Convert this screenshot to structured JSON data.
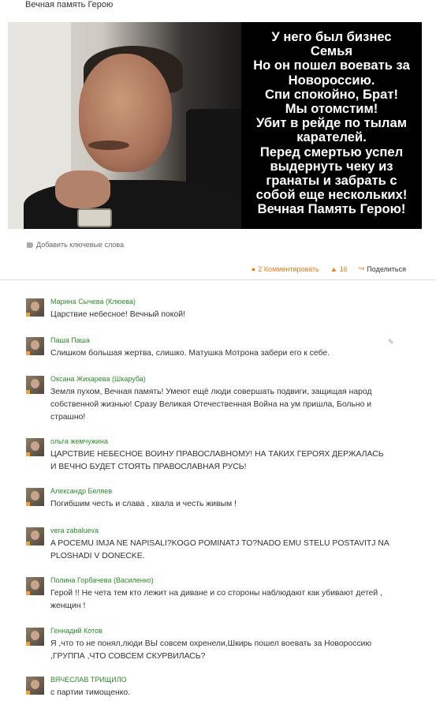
{
  "post": {
    "title": "Вечная память Герою",
    "image_caption_lines": [
      "У него был бизнес",
      "Семья",
      "Но он пошел воевать за",
      "Новороссию.",
      "Спи спокойно, Брат!",
      "Мы отомстим!",
      "Убит в рейде по тылам",
      "карателей.",
      "Перед смертью успел",
      "выдернуть чеку из",
      "гранаты и забрать с",
      "собой еще нескольких!",
      "Вечная Память Герою!"
    ],
    "keywords_link": "Добавить ключевые слова"
  },
  "actions": {
    "comment_label": "2 Комментировать",
    "likes_count": "16",
    "share_label": "Поделиться"
  },
  "colors": {
    "accent": "#eb7a1e",
    "author_name": "#2d8b2d",
    "text": "#333333"
  },
  "comments": [
    {
      "author": "Марина Сычева (Клюева)",
      "text": "Царствие небесное! Вечный покой!"
    },
    {
      "author": "Паша Паша",
      "text": "Слишком большая жертва, слишко. Матушка Мотрона забери его к себе."
    },
    {
      "author": "Оксана Жихарева (Шкаруба)",
      "lines": [
        "Земля пухом, Вечная память! Умеют ещё люди совершать подвиги, защищая народ",
        "собственной жизнью! Сразу Великая Отечественная Война на ум пришла, Больно и",
        "страшно!"
      ]
    },
    {
      "author": "ольга жемчужина",
      "lines": [
        "ЦАРСТВИЕ НЕБЕСНОЕ  ВОИНУ ПРАВОСЛАВНОМУ! НА ТАКИХ ГЕРОЯХ ДЕРЖАЛАСЬ",
        "И ВЕЧНО БУДЕТ СТОЯТЬ ПРАВОСЛАВНАЯ РУСЬ!"
      ]
    },
    {
      "author": "Александр Беляев",
      "text": "Погибшим  честь  и  слава ,  хвала  и  честь  живым !"
    },
    {
      "author": "vera zabalueva",
      "lines": [
        "A POCEMU IMJA NE NAPISALI?KOGO POMINATJ TO?NADO EMU STELU POSTAVITJ NA",
        "PLOSHADI V DONECKE."
      ]
    },
    {
      "author": "Полина Горбачева (Василенко)",
      "lines": [
        "Герой !! Не чета тем кто лежит на диване и со стороны наблюдают как убивают детей ,",
        "женщин !"
      ]
    },
    {
      "author": "Геннадий Котов",
      "lines": [
        "Я ,что то не понял,люди ВЫ совсем охренели,Шкирь пошел воевать за Новороссию",
        ",ГРУППА ,ЧТО СОВСЕМ СКУРВИЛАСЬ?"
      ]
    },
    {
      "author": "ВЯЧЕСЛАВ ТРИЩИЛО",
      "text": "с партии тимощенко."
    }
  ]
}
